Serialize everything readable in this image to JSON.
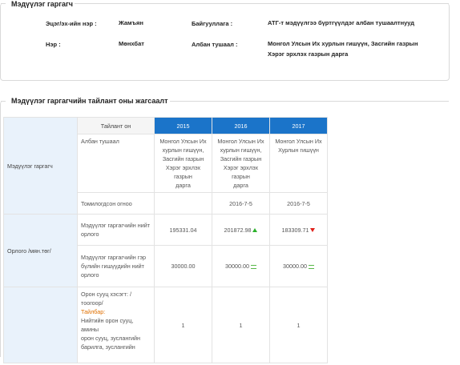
{
  "section1": {
    "legend": "Мэдүүлэг гаргагч",
    "family_name_label": "Эцэг/эх-ийн нэр :",
    "family_name_value": "Жамъян",
    "org_label": "Байгууллага :",
    "org_value": "АТГ-т мэдүүлгээ бүртгүүлдэг албан тушаалтнууд",
    "name_label": "Нэр :",
    "name_value": "Мөнхбат",
    "position_label": "Албан тушаал :",
    "position_value_line1": "Монгол Улсын Их хурлын гишүүн, Засгийн газрын",
    "position_value_line2": "Хэрэг эрхлэх газрын дарга"
  },
  "section2": {
    "legend": "Мэдүүлэг гаргагчийн тайлант оны жагсаалт",
    "group_declarant": "Мэдүүлэг гаргагч",
    "group_income": "Орлого /мян.төг/",
    "report_year_label": "Тайлант он",
    "years": [
      "2015",
      "2016",
      "2017"
    ],
    "row_position_label": "Албан тушаал",
    "positions": [
      [
        "Монгол Улсын Их",
        "хурлын гишүүн,",
        "Засгийн газрын",
        "Хэрэг эрхлэх газрын",
        "дарга"
      ],
      [
        "Монгол Улсын Их",
        "хурлын гишүүн,",
        "Засгийн газрын",
        "Хэрэг эрхлэх газрын",
        "дарга"
      ],
      [
        "Монгол Улсын Их",
        "Хурлын гишүүн"
      ]
    ],
    "row_appointed_label": "Томилогдсон огноо",
    "appointed": [
      "",
      "2016-7-5",
      "2016-7-5"
    ],
    "row_total_income_label_1": "Мэдүүлэг гаргагчийн нийт",
    "row_total_income_label_2": "орлого",
    "total_income": [
      "195331.04",
      "201872.98",
      "183309.71"
    ],
    "total_income_trend": [
      "none",
      "up",
      "down"
    ],
    "row_family_income_label_1": "Мэдүүлэг гаргагчийн гэр",
    "row_family_income_label_2": "бүлийн гишүүдийн нийт",
    "row_family_income_label_3": "орлого",
    "family_income": [
      "30000.00",
      "30000.00",
      "30000.00"
    ],
    "row_housing_label_1": "Орон сууц хэсэгт: /тоогоор/",
    "row_housing_label_ttl": "Тайлбар:",
    "row_housing_label_3": "Нийтийн орон сууц, амины",
    "row_housing_label_4": "орон сууц, зуслангийн",
    "row_housing_label_5": "барилга, зуслангийн",
    "housing": [
      "1",
      "1",
      "1"
    ]
  },
  "colors": {
    "year_header_bg": "#1b74c9",
    "side_bg": "#e9f2fb",
    "up": "#2bb12b",
    "down": "#e0201a",
    "equal": "#58b848",
    "note": "#e07000"
  }
}
